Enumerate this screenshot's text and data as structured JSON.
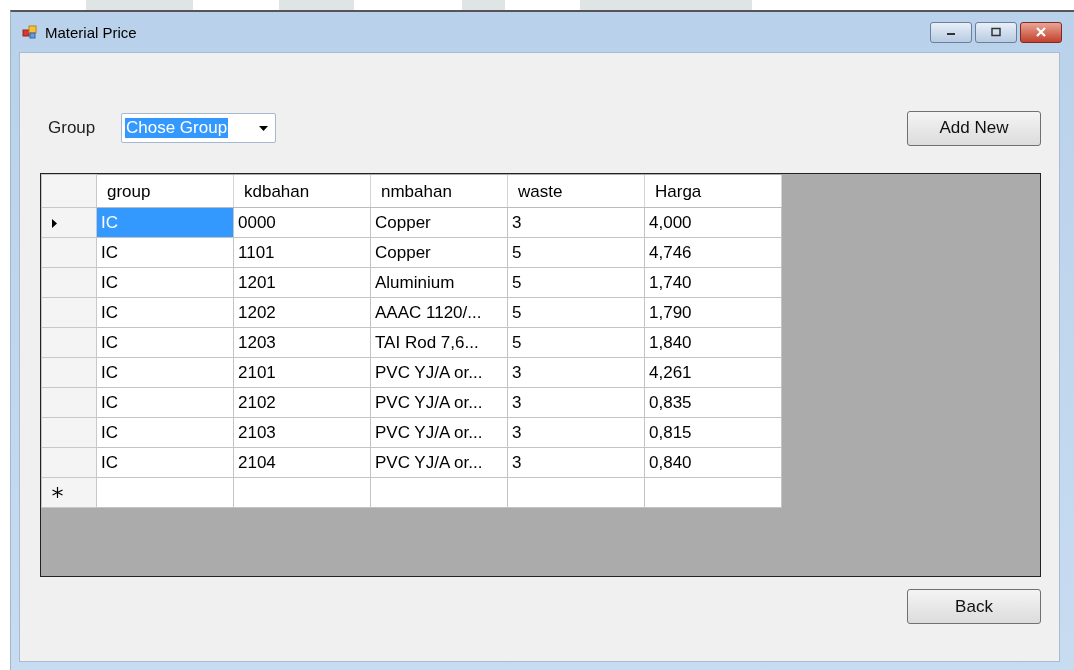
{
  "window": {
    "title": "Material Price"
  },
  "group_filter": {
    "label": "Group",
    "value": "Chose Group",
    "text_selected": true
  },
  "add_button": "Add New",
  "table": {
    "columns": [
      "group",
      "kdbahan",
      "nmbahan",
      "waste",
      "Harga"
    ],
    "rows": [
      {
        "selected": true,
        "cells": [
          "IC",
          "0000",
          "Copper",
          "3",
          "4,000"
        ]
      },
      {
        "selected": false,
        "cells": [
          "IC",
          "1101",
          "Copper",
          "5",
          "4,746"
        ]
      },
      {
        "selected": false,
        "cells": [
          "IC",
          "1201",
          "Aluminium",
          "5",
          "1,740"
        ]
      },
      {
        "selected": false,
        "cells": [
          "IC",
          "1202",
          "AAAC 1120/...",
          "5",
          "1,790"
        ]
      },
      {
        "selected": false,
        "cells": [
          "IC",
          "1203",
          "TAI Rod 7,6...",
          "5",
          "1,840"
        ]
      },
      {
        "selected": false,
        "cells": [
          "IC",
          "2101",
          "PVC YJ/A or...",
          "3",
          "4,261"
        ]
      },
      {
        "selected": false,
        "cells": [
          "IC",
          "2102",
          "PVC YJ/A or...",
          "3",
          "0,835"
        ]
      },
      {
        "selected": false,
        "cells": [
          "IC",
          "2103",
          "PVC YJ/A or...",
          "3",
          "0,815"
        ]
      },
      {
        "selected": false,
        "cells": [
          "IC",
          "2104",
          "PVC YJ/A or...",
          "3",
          "0,840"
        ]
      }
    ]
  },
  "back_button": "Back"
}
